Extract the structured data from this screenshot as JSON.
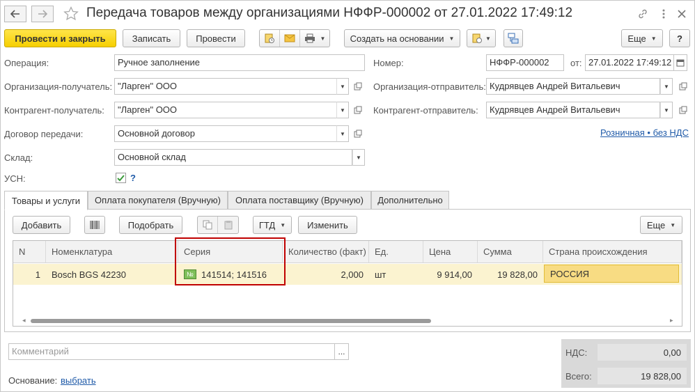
{
  "window": {
    "title": "Передача товаров между организациями НФФР-000002 от 27.01.2022 17:49:12"
  },
  "toolbar": {
    "post_close": "Провести и закрыть",
    "write": "Записать",
    "post": "Провести",
    "create_based": "Создать на основании",
    "more": "Еще",
    "help": "?"
  },
  "form": {
    "operation_label": "Операция:",
    "operation_value": "Ручное заполнение",
    "number_label": "Номер:",
    "number_value": "НФФР-000002",
    "date_label": "от:",
    "date_value": "27.01.2022 17:49:12",
    "org_recipient_label": "Организация-получатель:",
    "org_recipient_value": "\"Ларген\" ООО",
    "org_sender_label": "Организация-отправитель:",
    "org_sender_value": "Кудрявцев Андрей Витальевич",
    "contr_recipient_label": "Контрагент-получатель:",
    "contr_recipient_value": "\"Ларген\" ООО",
    "contr_sender_label": "Контрагент-отправитель:",
    "contr_sender_value": "Кудрявцев Андрей Витальевич",
    "contract_label": "Договор передачи:",
    "contract_value": "Основной договор",
    "warehouse_label": "Склад:",
    "warehouse_value": "Основной склад",
    "usn_label": "УСН:",
    "usn_help": "?",
    "usn_checked": true,
    "price_link": "Розничная • без НДС"
  },
  "tabs": [
    {
      "label": "Товары и услуги",
      "active": true
    },
    {
      "label": "Оплата покупателя (Вручную)",
      "active": false
    },
    {
      "label": "Оплата поставщику (Вручную)",
      "active": false
    },
    {
      "label": "Дополнительно",
      "active": false
    }
  ],
  "table_toolbar": {
    "add": "Добавить",
    "pick": "Подобрать",
    "gtd": "ГТД",
    "change": "Изменить",
    "more": "Еще"
  },
  "table": {
    "columns": [
      "N",
      "Номенклатура",
      "Серия",
      "Количество (факт)",
      "Ед.",
      "Цена",
      "Сумма",
      "Страна происхождения"
    ],
    "rows": [
      {
        "n": "1",
        "item": "Bosch BGS 42230",
        "series_icon": "№",
        "series": "141514; 141516",
        "qty": "2,000",
        "unit": "шт",
        "price": "9 914,00",
        "sum": "19 828,00",
        "country": "РОССИЯ"
      }
    ]
  },
  "footer": {
    "comment_placeholder": "Комментарий",
    "comment_btn": "...",
    "basis_label": "Основание:",
    "basis_link": "выбрать",
    "vat_label": "НДС:",
    "vat_value": "0,00",
    "total_label": "Всего:",
    "total_value": "19 828,00"
  },
  "colors": {
    "primary_button": "#f6cf00",
    "selected_row": "#fbf3d0",
    "highlight_frame": "#c00000",
    "link": "#1f5aa8",
    "checkbox": "#3a9a3a"
  }
}
